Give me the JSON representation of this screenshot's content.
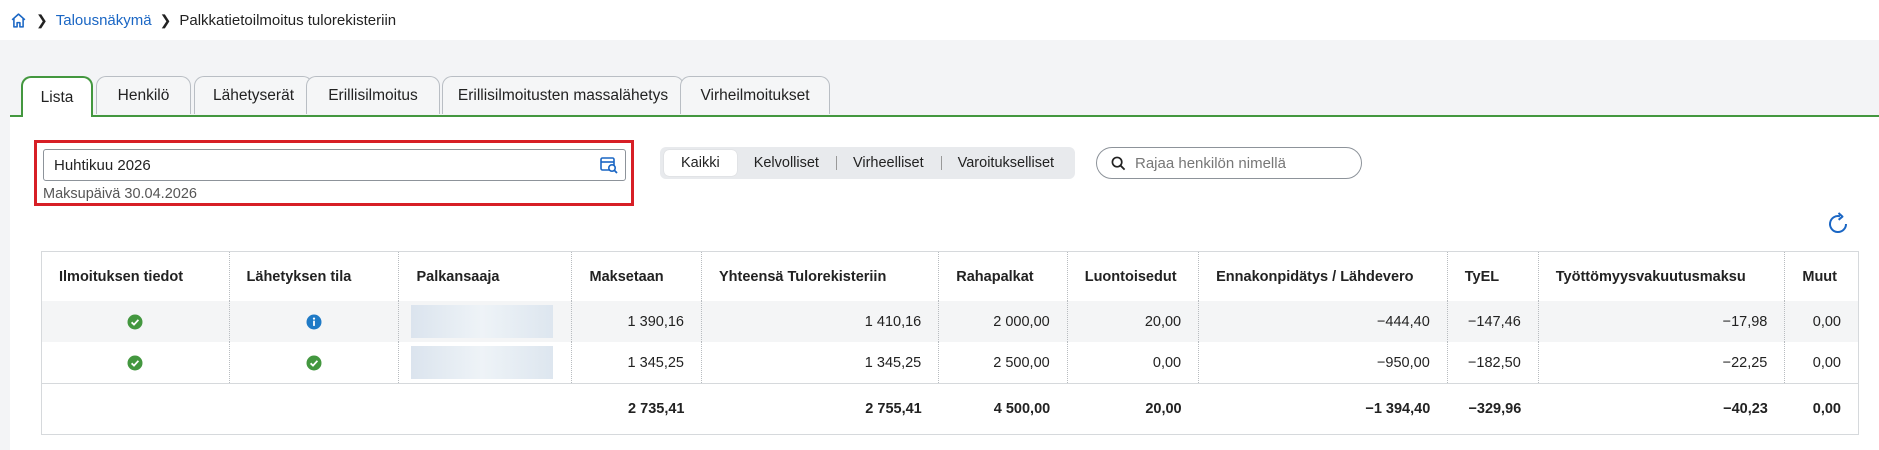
{
  "breadcrumb": {
    "home_icon": "home-icon",
    "items": [
      "Talousnäkymä",
      "Palkkatietoilmoitus tulorekisteriin"
    ]
  },
  "tabs": [
    {
      "label": "Lista",
      "active": true
    },
    {
      "label": "Henkilö"
    },
    {
      "label": "Lähetyserät"
    },
    {
      "label": "Erillisilmoitus"
    },
    {
      "label": "Erillisilmoitusten massalähetys"
    },
    {
      "label": "Virheilmoitukset"
    }
  ],
  "period": {
    "value": "Huhtikuu 2026",
    "payday": "Maksupäivä 30.04.2026",
    "icon": "calendar-search-icon"
  },
  "filters": [
    {
      "label": "Kaikki",
      "active": true
    },
    {
      "label": "Kelvolliset"
    },
    {
      "label": "Virheelliset"
    },
    {
      "label": "Varoitukselliset"
    }
  ],
  "search": {
    "placeholder": "Rajaa henkilön nimellä",
    "icon": "search-icon"
  },
  "colors": {
    "accent_green": "#43973f",
    "link_blue": "#1a66c4",
    "highlight_red": "#d71f26",
    "ok_green": "#43973f",
    "info_blue": "#1f7ac6"
  },
  "table": {
    "headers": [
      "Ilmoituksen tiedot",
      "Lähetyksen tila",
      "Palkansaaja",
      "Maksetaan",
      "Yhteensä Tulorekisteriin",
      "Rahapalkat",
      "Luontoisedut",
      "Ennakonpidätys / Lähdevero",
      "TyEL",
      "Työttömyysvakuutusmaksu",
      "Muut"
    ],
    "rows": [
      {
        "info_status": "ok",
        "send_status": "info",
        "payee": "",
        "maksetaan": "1 390,16",
        "yhteensa": "1 410,16",
        "rahapalkat": "2 000,00",
        "luontoisedut": "20,00",
        "ennakonpidatys": "−444,40",
        "tyel": "−147,46",
        "tyottomyys": "−17,98",
        "muut": "0,00"
      },
      {
        "info_status": "ok",
        "send_status": "ok",
        "payee": "",
        "maksetaan": "1 345,25",
        "yhteensa": "1 345,25",
        "rahapalkat": "2 500,00",
        "luontoisedut": "0,00",
        "ennakonpidatys": "−950,00",
        "tyel": "−182,50",
        "tyottomyys": "−22,25",
        "muut": "0,00"
      }
    ],
    "totals": {
      "maksetaan": "2 735,41",
      "yhteensa": "2 755,41",
      "rahapalkat": "4 500,00",
      "luontoisedut": "20,00",
      "ennakonpidatys": "−1 394,40",
      "tyel": "−329,96",
      "tyottomyys": "−40,23",
      "muut": "0,00"
    }
  }
}
